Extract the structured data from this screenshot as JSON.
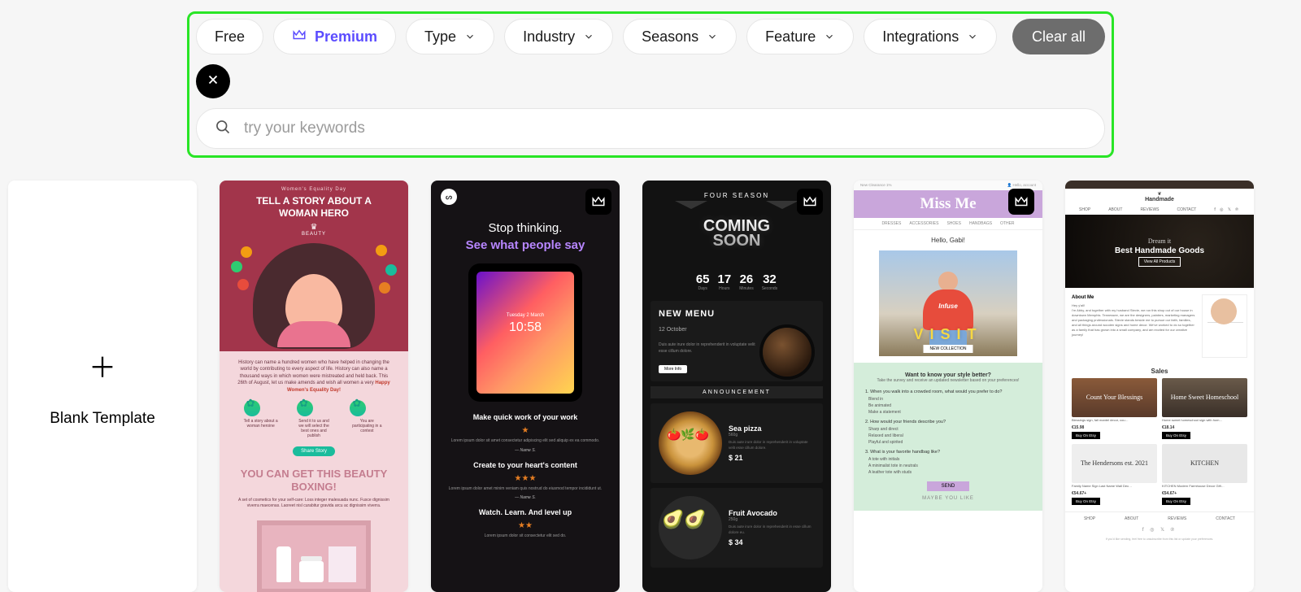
{
  "filters": {
    "free": "Free",
    "premium": "Premium",
    "type": "Type",
    "industry": "Industry",
    "seasons": "Seasons",
    "feature": "Feature",
    "integrations": "Integrations",
    "clear_all": "Clear all"
  },
  "search": {
    "placeholder": "try your keywords"
  },
  "blank_template_label": "Blank Template",
  "templates": {
    "t1": {
      "top_tag": "Women's Equality Day",
      "headline": "TELL A STORY ABOUT A WOMAN HERO",
      "brand": "BEAUTY",
      "desc": "History can name a hundred women who have helped in changing the world by contributing to every aspect of life. History can also name a thousand ways in which women were mistreated and held back. This 26th of August, let us make amends and wish all women a very",
      "desc_highlight": "Happy Women's Equality Day!",
      "icon_labels": [
        "Tell a story about a woman heroine",
        "Send it to us and we will select the best ones and publish",
        "You are participating in a contest"
      ],
      "cta": "Share Story",
      "subhead": "YOU CAN GET THIS BEAUTY BOXING!",
      "desc2": "A set of cosmetics for your self-care: Loss integer malesuada nunc. Fusce dignissim viverra maecenas. Laoreet nisl curabitur gravida arcu ac dignissim viverra."
    },
    "t2": {
      "h1": "Stop thinking.",
      "h2": "See what people say",
      "time": "10:58",
      "date": "Tuesday 2 March",
      "sections": [
        {
          "title": "Make quick work of your work",
          "stars": "★",
          "blurb": "Lorem ipsum dolor sit amet consectetur adipiscing elit sed aliquip ex ea commodo.",
          "sig": "— Name S."
        },
        {
          "title": "Create to your heart's content",
          "stars": "★★★",
          "blurb": "Lorem ipsum dolor amet minim veniam quis nostrud do eiusmod tempor incididunt ut.",
          "sig": "— Name S."
        },
        {
          "title": "Watch. Learn. And level up",
          "stars": "★★",
          "blurb": "Lorem ipsum dolor sit consectetur elit sed do.",
          "sig": ""
        }
      ]
    },
    "t3": {
      "brand": "FOUR SEASON",
      "coming": "COMING\nSOON",
      "countdown": [
        {
          "n": "65",
          "l": "Days"
        },
        {
          "n": "17",
          "l": "Hours"
        },
        {
          "n": "26",
          "l": "Minutes"
        },
        {
          "n": "32",
          "l": "Seconds"
        }
      ],
      "menu_title": "NEW MENU",
      "menu_date": "12 October",
      "menu_desc": "Duis aute irure dolor in reprehenderit in voluptate velit esse cillum dolore.",
      "more_info": "More Info",
      "announcement": "ANNOUNCEMENT",
      "dishes": [
        {
          "name": "Sea pizza",
          "wt": "560g",
          "desc": "Duis aute irure dolor in reprehenderit in voluptate velit esse cillum dolore.",
          "price": "$ 21"
        },
        {
          "name": "Fruit Avocado",
          "wt": "250g",
          "desc": "Duis aute irure dolor in reprehenderit in esse cillum dolore eu.",
          "price": "$ 34"
        }
      ]
    },
    "t4": {
      "top_left": "New Clearance 1%",
      "top_right": "👤 Hello, account",
      "logo": "Miss Me",
      "nav": [
        "DRESSES",
        "ACCESSORIES",
        "SHOES",
        "HANDBAGS",
        "OTHER"
      ],
      "hello": "Hello, Gabi!",
      "visit": "VISIT",
      "new_collection": "NEW COLLECTION",
      "survey": {
        "title": "Want to know your style better?",
        "sub": "Take the survey and receive an updated newsletter based on your preferences!",
        "q1": "1. When you walk into a crowded room, what would you prefer to do?",
        "q1_opts": [
          "Blend in",
          "Be animated",
          "Make a statement"
        ],
        "q2": "2. How would your friends describe you?",
        "q2_opts": [
          "Sharp and direct",
          "Relaxed and liberal",
          "Playful and spirited"
        ],
        "q3": "3. What is your favorite handbag like?",
        "q3_opts": [
          "A tote with initials",
          "A minimalist tote in neutrals",
          "A leather tote with studs"
        ],
        "send": "SEND",
        "maybe": "MAYBE YOU LIKE"
      }
    },
    "t5": {
      "brand": "Handmade",
      "nav": [
        "SHOP",
        "ABOUT",
        "REVIEWS",
        "CONTACT"
      ],
      "hero_slogan": "Dream it",
      "hero_main": "Best Handmade Goods",
      "hero_btn": "View All Products",
      "about_title": "About Me",
      "about_greet": "Hey y'all!",
      "about_text": "I'm Abby, and together with my husband Stevie, we run this shop out of our house in downtown Memphis. Tennessee, we are the designers, painters, marketing managers and packaging professionals. Stevie stands beside me to pursue our faith, families, and all things around wooden signs and home decor. We've worked to do so together as a family that has grown into a small company, and am excited for our creative journey!",
      "sales": "Sales",
      "products": [
        {
          "img": "Count Your Blessings",
          "name": "Blessings sign, fall mantel decor, cou…",
          "price": "€15.98",
          "btn": "Buy On Etsy"
        },
        {
          "img": "Home Sweet Homeschool",
          "name": "Home sweet homeschool sign with hom…",
          "price": "€18.14",
          "btn": "Buy On Etsy"
        },
        {
          "img": "The Hendersons est. 2021",
          "name": "Family Name Sign Last Name Wall Dec…",
          "price": "€54.67+",
          "btn": "Buy On Etsy"
        },
        {
          "img": "KITCHEN",
          "name": "KITCHEN Modern Farmhouse Decor Gift…",
          "price": "€54.67+",
          "btn": "Buy On Etsy"
        }
      ],
      "footer_nav": [
        "SHOP",
        "ABOUT",
        "REVIEWS",
        "CONTACT"
      ],
      "footer_note": "If you'd like sending, feel free to unsubscribe from this list or update your preferences."
    }
  }
}
